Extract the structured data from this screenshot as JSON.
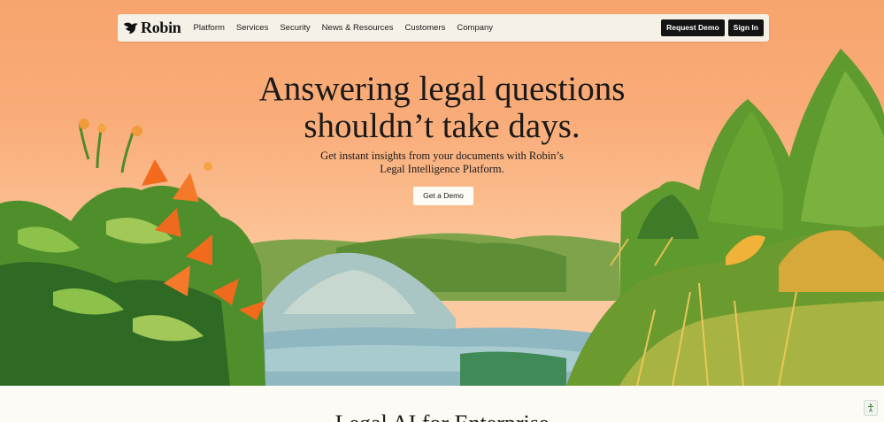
{
  "nav": {
    "logo_icon": "robin-bird-icon",
    "logo_text": "Robin",
    "links": [
      "Platform",
      "Services",
      "Security",
      "News & Resources",
      "Customers",
      "Company"
    ],
    "request_demo": "Request Demo",
    "sign_in": "Sign In"
  },
  "hero": {
    "headline_line1": "Answering legal questions",
    "headline_line2": "shouldn’t take days.",
    "subhead_line1": "Get instant insights from your documents with Robin’s",
    "subhead_line2": "Legal Intelligence Platform.",
    "cta": "Get a Demo",
    "illustration": "landscape-illustration"
  },
  "next_section": {
    "title": "Legal AI for Enterprise"
  },
  "floating_widget": {
    "icon": "accessibility-icon"
  },
  "colors": {
    "sky_top": "#f8a46e",
    "sky_bottom": "#fccaa0",
    "nav_bg": "#f6f1e7",
    "button_dark": "#141414",
    "page_bg": "#fdfbf5"
  }
}
